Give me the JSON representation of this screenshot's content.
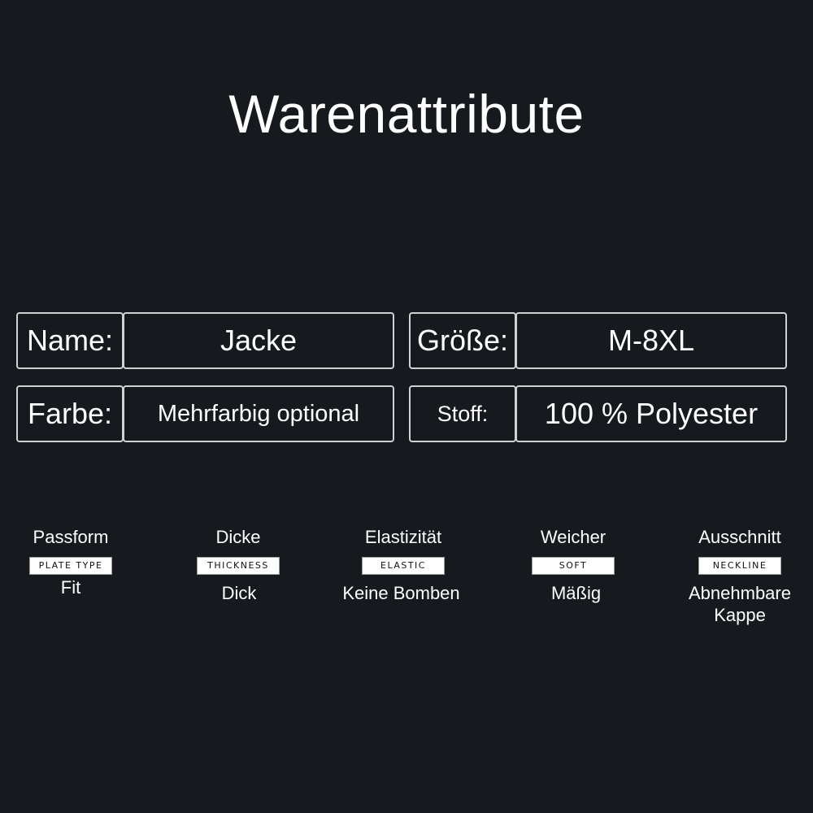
{
  "title": "Warenattribute",
  "properties": [
    {
      "label": "Name:",
      "value": "Jacke"
    },
    {
      "label": "Größe:",
      "value": "M-8XL"
    },
    {
      "label": "Farbe:",
      "value": "Mehrfarbig optional"
    },
    {
      "label": "Stoff:",
      "value": "100 % Polyester"
    }
  ],
  "attributes": [
    {
      "label": "Passform",
      "tag": "PLATE TYPE",
      "value": "Fit"
    },
    {
      "label": "Dicke",
      "tag": "THICKNESS",
      "value": "Dick"
    },
    {
      "label": "Elastizität",
      "tag": "ELASTIC",
      "value": "Keine Bomben"
    },
    {
      "label": "Weicher",
      "tag": "SOFT",
      "value": "Mäßig"
    },
    {
      "label": "Ausschnitt",
      "tag": "NECKLINE",
      "value": "Abnehmbare Kappe"
    }
  ]
}
